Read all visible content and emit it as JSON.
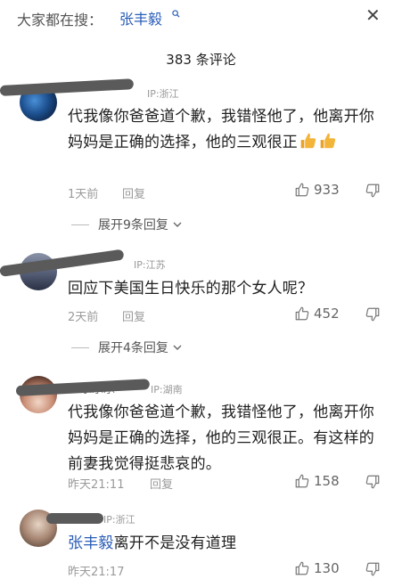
{
  "search_bar": {
    "prefix": "大家都在搜：",
    "keyword": "张丰毅"
  },
  "comment_count": "383 条评论",
  "comments": [
    {
      "ip": "IP:浙江",
      "text_main": "代我像你爸爸道个歉，我错怪他了，他离开你妈妈是正确的选择，他的三观很正",
      "time": "1天前",
      "reply": "回复",
      "likes": "933",
      "expand": "展开9条回复"
    },
    {
      "ip": "IP:江苏",
      "text_main": "回应下美国生日快乐的那个女人呢？",
      "time": "2天前",
      "reply": "回复",
      "likes": "452",
      "expand": "展开4条回复"
    },
    {
      "name_fragment": "\"乐乐乐\"",
      "ip": "IP:湖南",
      "text_main": "代我像你爸爸道个歉，我错怪他了，他离开你妈妈是正确的选择，他的三观很正。有这样的前妻我觉得挺悲哀的。",
      "time": "昨天21:11",
      "reply": "回复",
      "likes": "158"
    },
    {
      "ip": "IP:浙江",
      "mention": "张丰毅",
      "text_main": "离开不是没有道理",
      "time": "昨天21:17",
      "likes": "130"
    }
  ],
  "icons": {
    "search": "search-icon",
    "close": "close-icon",
    "like": "thumbs-up-outline-icon",
    "dislike": "thumbs-down-outline-icon",
    "emoji": "thumbs-up-emoji-icon",
    "chevron": "chevron-down-icon"
  },
  "colors": {
    "link": "#2a5db8",
    "emoji": "#f3b43a"
  }
}
